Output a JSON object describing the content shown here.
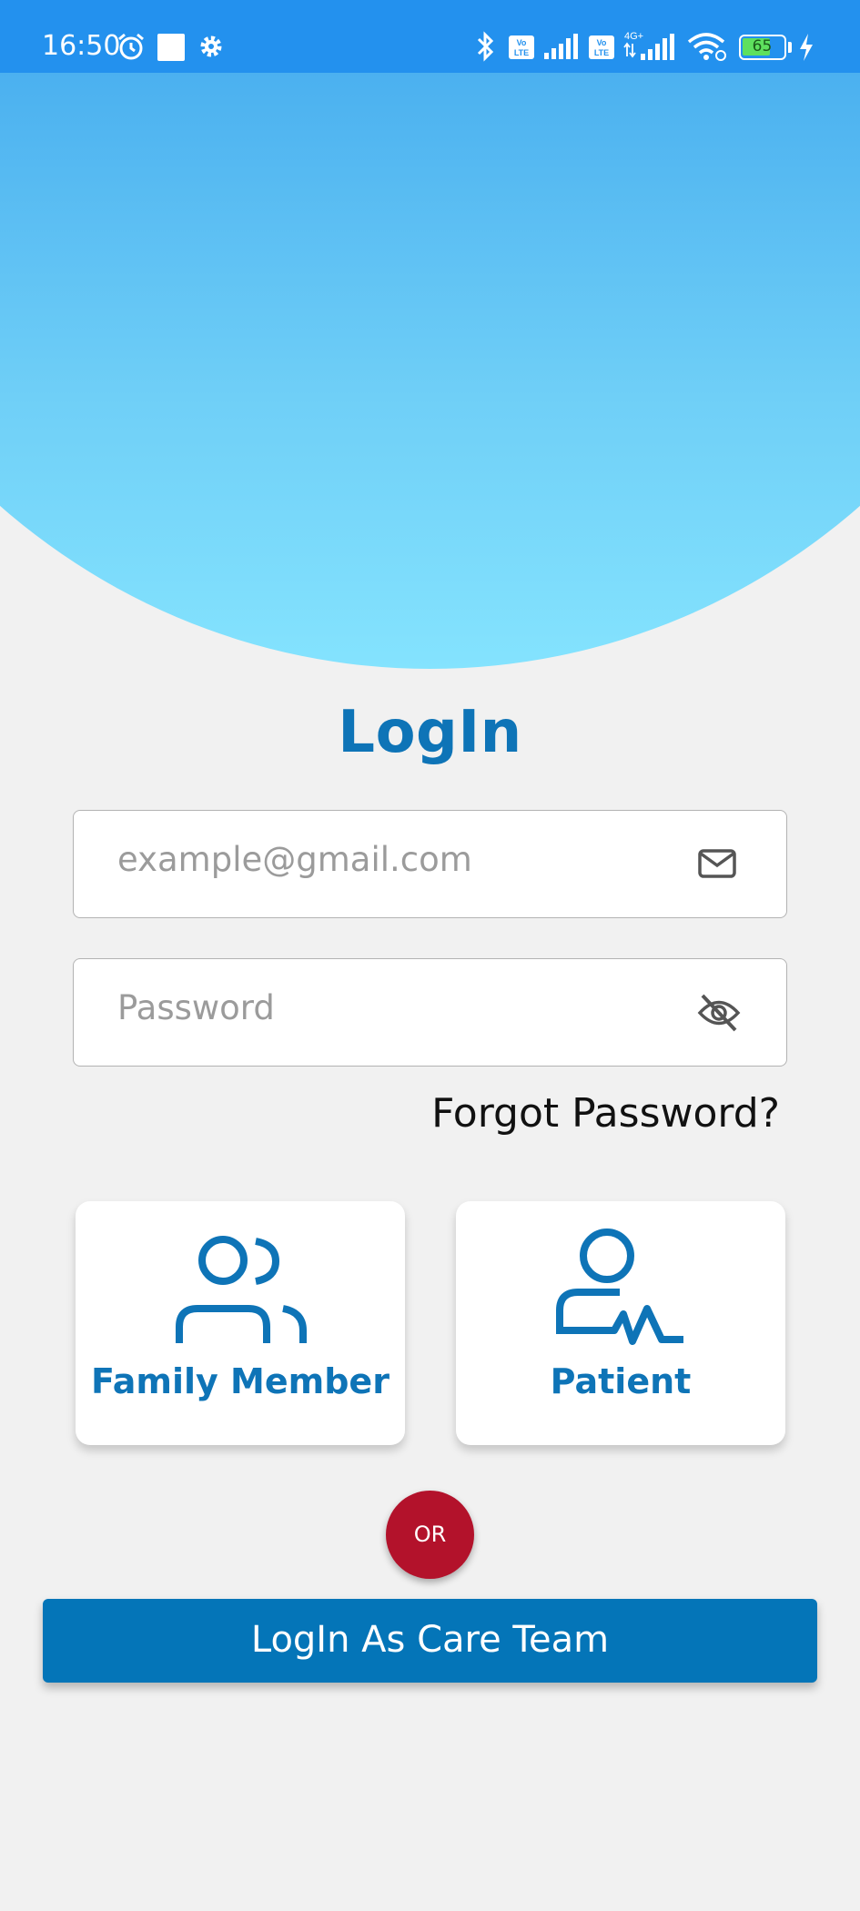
{
  "status_bar": {
    "time": "16:50",
    "battery": "65",
    "icons": [
      "alarm-icon",
      "square-icon",
      "settings-icon",
      "bluetooth-icon",
      "volte-icon",
      "signal-icon",
      "volte-icon",
      "4g-signal-icon",
      "wifi-icon",
      "battery-icon",
      "charging-icon"
    ]
  },
  "login": {
    "title": "LogIn",
    "email_placeholder": "example@gmail.com",
    "password_placeholder": "Password",
    "forgot_password": "Forgot Password?"
  },
  "roles": [
    {
      "label": "Family Member",
      "icon": "users-icon"
    },
    {
      "label": "Patient",
      "icon": "patient-heartbeat-icon"
    }
  ],
  "divider_label": "OR",
  "care_team_button": "LogIn As Care Team",
  "colors": {
    "primary": "#0e74b7",
    "button": "#0475b8",
    "or_badge": "#b3122b",
    "status_bar": "#2391ee"
  }
}
